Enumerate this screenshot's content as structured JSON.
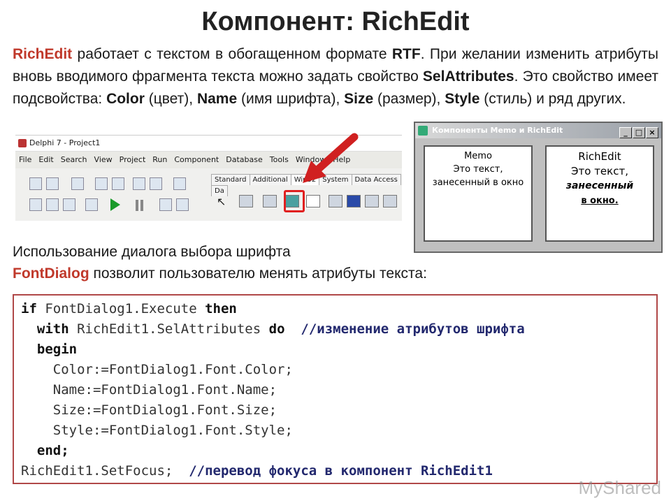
{
  "title": "Компонент: RichEdit",
  "intro": {
    "t1": "RichEdit",
    "t2": " работает с текстом в обогащенном формате ",
    "t3": "RTF",
    "t4": ". При желании изменить атрибуты вновь вводимого фрагмента текста можно задать свойство ",
    "t5": "SelAttributes",
    "t6": ". Это свойство имеет подсвойства: ",
    "t7": "Color",
    "t8": " (цвет), ",
    "t9": "Name",
    "t10": " (имя шрифта), ",
    "t11": "Size",
    "t12": " (размер), ",
    "t13": "Style",
    "t14": " (стиль) и ряд других."
  },
  "ide": {
    "title": "Delphi 7 - Project1",
    "menu": [
      "File",
      "Edit",
      "Search",
      "View",
      "Project",
      "Run",
      "Component",
      "Database",
      "Tools",
      "Window",
      "Help"
    ],
    "tabs": [
      "Standard",
      "Additional",
      "Win32",
      "System",
      "Data Access",
      "Da"
    ]
  },
  "window": {
    "title": "Компоненты Memo и RichEdit",
    "buttons": [
      "_",
      "□",
      "×"
    ],
    "memo": [
      "Memo",
      "Это текст,",
      "занесенный в окно"
    ],
    "rich": [
      "RichEdit",
      "Это текст,",
      "занесенный",
      "в окно."
    ]
  },
  "dialog": {
    "line1": "Использование диалога выбора шрифта",
    "name": "FontDialog",
    "rest": " позволит пользователю менять атрибуты текста:"
  },
  "code": {
    "l1a": "if",
    "l1b": " FontDialog1.Execute ",
    "l1c": "then",
    "l2a": "  with",
    "l2b": " RichEdit1.SelAttributes ",
    "l2c": "do",
    "l2d": "  //изменение атрибутов шрифта",
    "l3": "  begin",
    "l4": "    Color:=FontDialog1.Font.Color;",
    "l5": "    Name:=FontDialog1.Font.Name;",
    "l6": "    Size:=FontDialog1.Font.Size;",
    "l7": "    Style:=FontDialog1.Font.Style;",
    "l8": "  end;",
    "l9a": "RichEdit1.SetFocus;",
    "l9b": "  //перевод фокуса в компонент RichEdit1"
  },
  "watermark": "MyShared"
}
